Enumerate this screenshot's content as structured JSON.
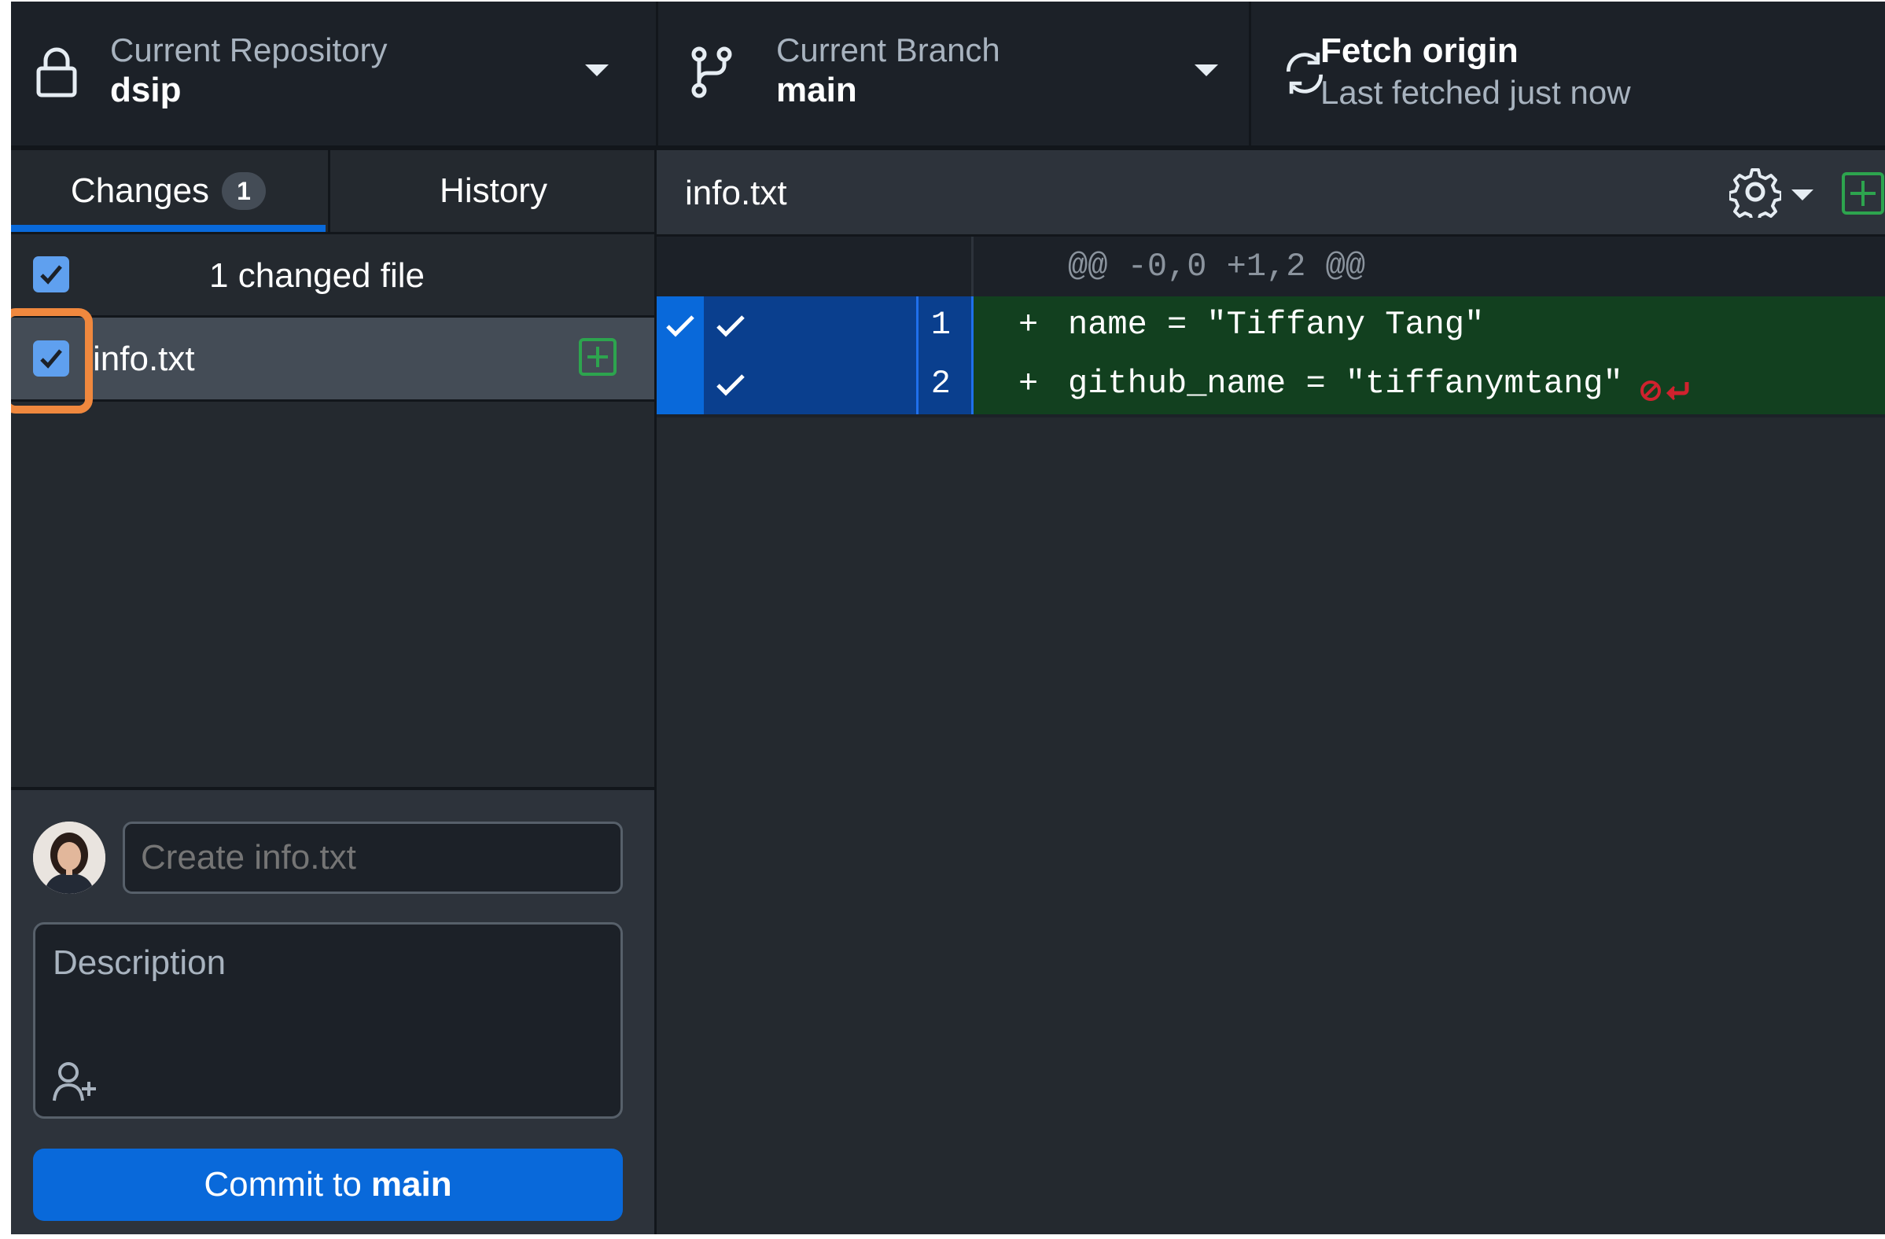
{
  "toolbar": {
    "repository": {
      "label": "Current Repository",
      "value": "dsip",
      "icon": "lock-icon"
    },
    "branch": {
      "label": "Current Branch",
      "value": "main",
      "icon": "git-branch-icon"
    },
    "fetch": {
      "title": "Fetch origin",
      "subtitle": "Last fetched just now",
      "icon": "sync-icon"
    }
  },
  "tabs": {
    "changes": {
      "label": "Changes",
      "count": "1"
    },
    "history": {
      "label": "History"
    }
  },
  "changes": {
    "header": "1 changed file",
    "files": [
      {
        "name": "info.txt",
        "checked": true,
        "status": "added"
      }
    ]
  },
  "commit": {
    "summary_placeholder": "Create info.txt",
    "description_placeholder": "Description",
    "button_prefix": "Commit to",
    "button_branch": "main"
  },
  "diff": {
    "file": "info.txt",
    "hunk_header": "@@ -0,0 +1,2 @@",
    "lines": [
      {
        "number": "1",
        "prefix": "+",
        "text": "name = \"Tiffany Tang\""
      },
      {
        "number": "2",
        "prefix": "+",
        "text": "github_name = \"tiffanymtang\"",
        "no_newline": true
      }
    ]
  },
  "colors": {
    "accent": "#0969da",
    "added_bg": "#12401f",
    "added_icon": "#2da44e",
    "highlight": "#f0883e",
    "no_newline": "#cf222e"
  }
}
